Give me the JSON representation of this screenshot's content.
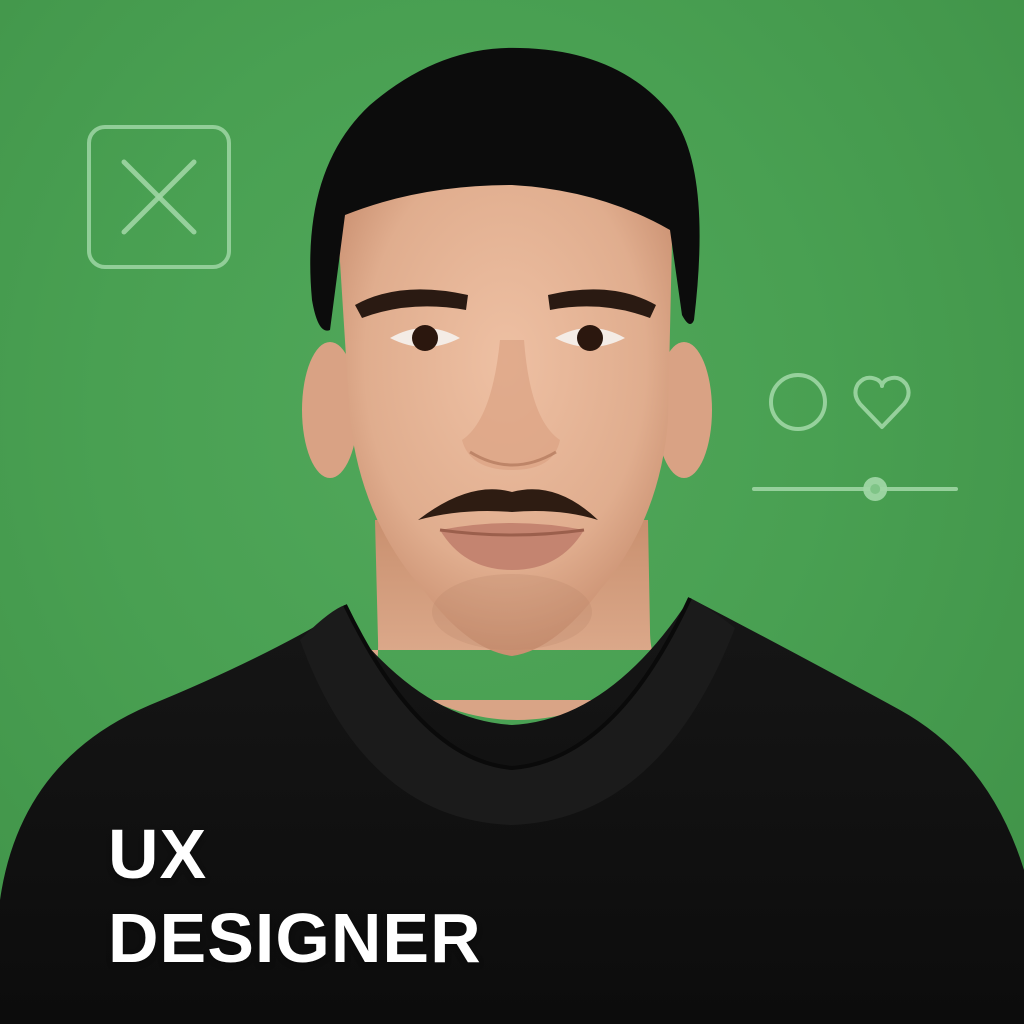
{
  "overlay": {
    "line1": "UX",
    "line2": "DESIGNER"
  },
  "icons": {
    "close": "close-icon",
    "circle": "circle-icon",
    "heart": "heart-icon",
    "slider": "slider-icon"
  },
  "slider": {
    "value_fraction": 0.6
  },
  "colors": {
    "background": "#4a9f53",
    "icon_stroke": "#9fd6a4",
    "shirt": "#0f0f0f",
    "hair": "#0b0b0b",
    "skin": "#e3b193",
    "text": "#ffffff"
  }
}
